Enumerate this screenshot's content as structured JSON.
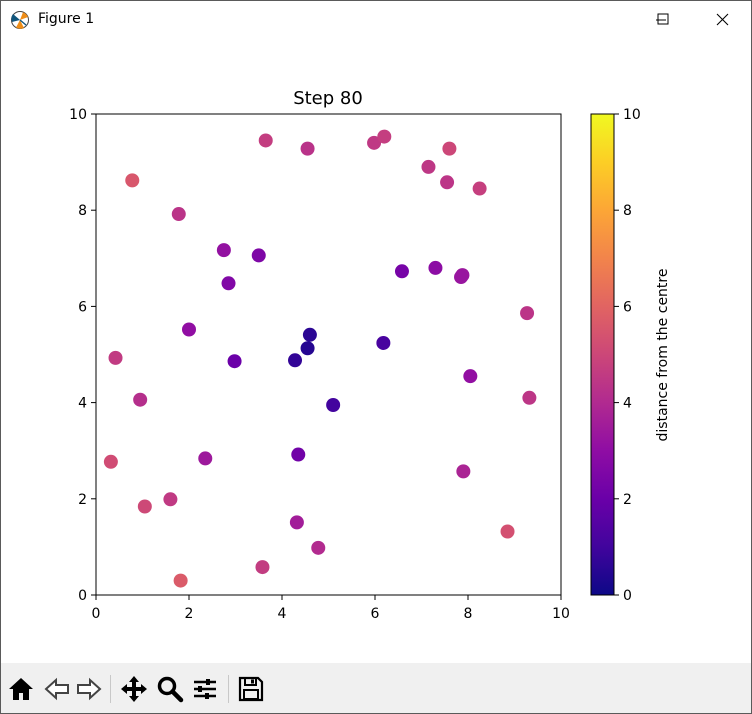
{
  "window": {
    "title": "Figure 1",
    "controls": {
      "minimize": "minimize",
      "maximize": "maximize",
      "close": "close"
    }
  },
  "toolbar": {
    "tools": [
      "home-icon",
      "back-icon",
      "forward-icon",
      "pan-icon",
      "zoom-icon",
      "configure-subplots-icon",
      "save-icon"
    ]
  },
  "chart_data": {
    "type": "scatter",
    "title": "Step 80",
    "xlabel": "",
    "ylabel": "",
    "xlim": [
      0,
      10
    ],
    "ylim": [
      0,
      10
    ],
    "xticks": [
      0,
      2,
      4,
      6,
      8,
      10
    ],
    "yticks": [
      0,
      2,
      4,
      6,
      8,
      10
    ],
    "grid": false,
    "colormap": "plasma",
    "color_value": "distance from the centre",
    "colorbar": {
      "label": "distance from the centre",
      "range": [
        0,
        10
      ],
      "ticks": [
        0,
        2,
        4,
        6,
        8,
        10
      ]
    },
    "points": [
      {
        "x": 3.65,
        "y": 9.45
      },
      {
        "x": 4.55,
        "y": 9.28
      },
      {
        "x": 5.98,
        "y": 9.4
      },
      {
        "x": 6.2,
        "y": 9.53
      },
      {
        "x": 7.6,
        "y": 9.28
      },
      {
        "x": 7.15,
        "y": 8.9
      },
      {
        "x": 7.55,
        "y": 8.58
      },
      {
        "x": 8.25,
        "y": 8.45
      },
      {
        "x": 0.78,
        "y": 8.62
      },
      {
        "x": 1.78,
        "y": 7.92
      },
      {
        "x": 2.75,
        "y": 7.17
      },
      {
        "x": 3.5,
        "y": 7.06
      },
      {
        "x": 2.85,
        "y": 6.48
      },
      {
        "x": 6.58,
        "y": 6.73
      },
      {
        "x": 7.3,
        "y": 6.8
      },
      {
        "x": 7.88,
        "y": 6.65
      },
      {
        "x": 7.85,
        "y": 6.61
      },
      {
        "x": 9.27,
        "y": 5.86
      },
      {
        "x": 2.0,
        "y": 5.52
      },
      {
        "x": 4.6,
        "y": 5.41
      },
      {
        "x": 4.55,
        "y": 5.13
      },
      {
        "x": 4.28,
        "y": 4.88
      },
      {
        "x": 6.18,
        "y": 5.24
      },
      {
        "x": 0.42,
        "y": 4.93
      },
      {
        "x": 2.98,
        "y": 4.86
      },
      {
        "x": 8.05,
        "y": 4.55
      },
      {
        "x": 0.95,
        "y": 4.06
      },
      {
        "x": 5.1,
        "y": 3.95
      },
      {
        "x": 9.32,
        "y": 4.1
      },
      {
        "x": 2.35,
        "y": 2.84
      },
      {
        "x": 4.35,
        "y": 2.92
      },
      {
        "x": 0.32,
        "y": 2.77
      },
      {
        "x": 7.9,
        "y": 2.57
      },
      {
        "x": 1.6,
        "y": 1.99
      },
      {
        "x": 1.05,
        "y": 1.84
      },
      {
        "x": 4.32,
        "y": 1.51
      },
      {
        "x": 8.85,
        "y": 1.32
      },
      {
        "x": 4.78,
        "y": 0.98
      },
      {
        "x": 3.58,
        "y": 0.58
      },
      {
        "x": 1.82,
        "y": 0.3
      }
    ]
  }
}
